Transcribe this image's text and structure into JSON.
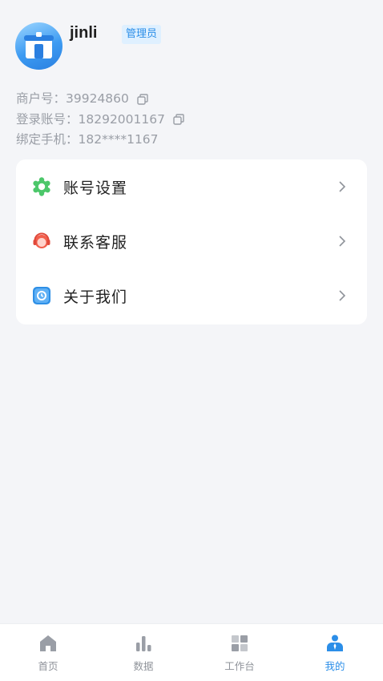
{
  "profile": {
    "username": "jinli",
    "role": "管理员"
  },
  "info": {
    "merchant": "商户号：39924860",
    "login": "登录账号：18292001167",
    "phone": "绑定手机：182****1167"
  },
  "menu": [
    {
      "label": "账号设置",
      "icon": "gear-icon",
      "color": "#4cc76a"
    },
    {
      "label": "联系客服",
      "icon": "headset-icon",
      "color": "#f25f4c"
    },
    {
      "label": "关于我们",
      "icon": "info-app-icon",
      "color": "#2e8fe6"
    }
  ],
  "tabs": [
    {
      "label": "首页",
      "icon": "home-icon"
    },
    {
      "label": "数据",
      "icon": "bar-chart-icon"
    },
    {
      "label": "工作台",
      "icon": "grid-icon"
    },
    {
      "label": "我的",
      "icon": "user-icon",
      "active": true
    }
  ],
  "colors": {
    "accent": "#2b8ee8",
    "background": "#f4f5f8",
    "muted_text": "#9a9ea6"
  }
}
